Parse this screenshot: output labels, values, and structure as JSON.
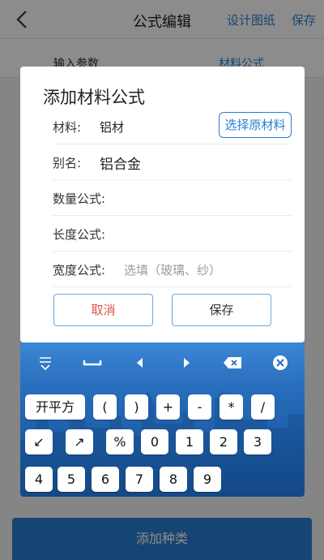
{
  "nav": {
    "title": "公式编辑",
    "design_drawing": "设计图纸",
    "save": "保存"
  },
  "tabs": [
    {
      "label": "输入参数"
    },
    {
      "label": "材料公式"
    }
  ],
  "bottom_button": "添加种类",
  "dialog": {
    "title": "添加材料公式",
    "material_label": "材料:",
    "material_value": "铝材",
    "select_material_button": "选择原材料",
    "alias_label": "别名:",
    "alias_value": "铝合金",
    "quantity_label": "数量公式:",
    "length_label": "长度公式:",
    "width_label": "宽度公式:",
    "width_placeholder": "选填（玻璃、纱）",
    "cancel": "取消",
    "save": "保存"
  },
  "keyboard": {
    "toolbar_icons": [
      "collapse-icon",
      "space-icon",
      "left-arrow-icon",
      "right-arrow-icon",
      "backspace-icon",
      "close-icon"
    ],
    "rows": [
      [
        "开平方",
        "(",
        ")",
        "+",
        "-",
        "*",
        "/"
      ],
      [
        "↙",
        "↗",
        "%",
        "0",
        "1",
        "2",
        "3"
      ],
      [
        "4",
        "5",
        "6",
        "7",
        "8",
        "9"
      ]
    ]
  },
  "colors": {
    "accent": "#2a7fd1",
    "cancel_red": "#d9534f",
    "keyboard_blue": "#2a6fbd"
  }
}
